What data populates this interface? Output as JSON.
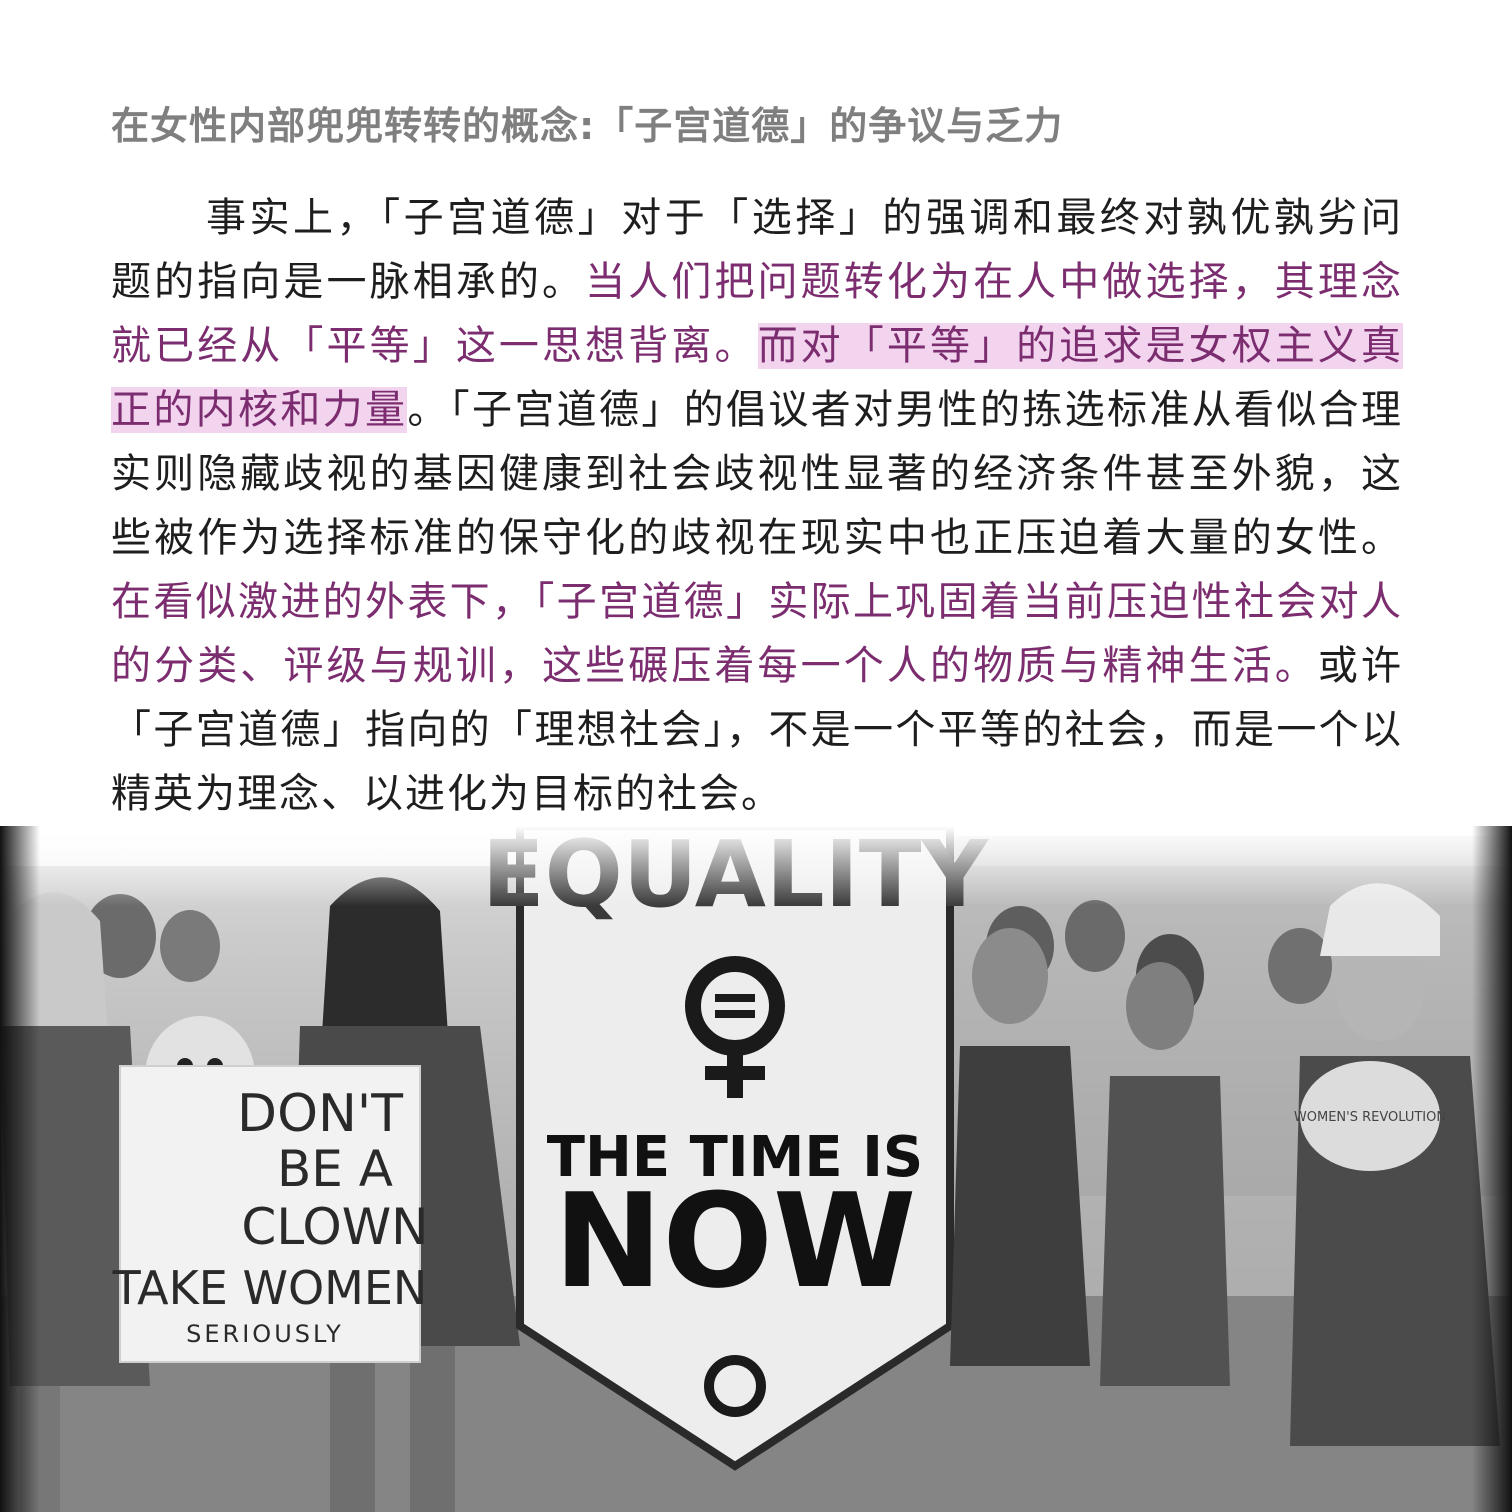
{
  "heading": "在女性内部兜兜转转的概念:「子宫道德」的争议与乏力",
  "paragraph": {
    "segments": [
      {
        "text": "事实上，「子宫道德」对于「选择」的强调和最终对孰优孰劣问题的指向是一脉相承的。",
        "style": "normal"
      },
      {
        "text": "当人们把问题转化为在人中做选择，其理念就已经从「平等」这一思想背离。",
        "style": "purple"
      },
      {
        "text": "而对「平等」的追求是女权主义真正的内核和力量",
        "style": "purple-highlight"
      },
      {
        "text": "。「子宫道德」的倡议者对男性的拣选标准从看似合理实则隐藏歧视的基因健康到社会歧视性显著的经济条件甚至外貌，这些被作为选择标准的保守化的歧视在现实中也正压迫着大量的女性。",
        "style": "normal"
      },
      {
        "text": "在看似激进的外表下，「子宫道德」实际上巩固着当前压迫性社会对人的分类、评级与规训，这些碾压着每一个人的物质与精神生活。",
        "style": "purple"
      },
      {
        "text": "或许「子宫道德」指向的「理想社会」，不是一个平等的社会，而是一个以精英为理念、以进化为目标的社会。",
        "style": "normal"
      }
    ]
  },
  "photo": {
    "banner_top": "EQUALITY",
    "banner_middle": "THE TIME IS",
    "banner_bottom": "NOW",
    "sign_line1": "DON'T",
    "sign_line2": "BE A",
    "sign_line3": "CLOWN",
    "sign_line4": "TAKE WOMEN",
    "sign_line5": "SERIOUSLY",
    "medallion_text": "WOMEN'S REVOLUTION"
  },
  "colors": {
    "heading": "#7f7f7f",
    "text": "#1e1e1e",
    "accent_purple": "#7b2d6f",
    "highlight": "#f2d4ef"
  }
}
